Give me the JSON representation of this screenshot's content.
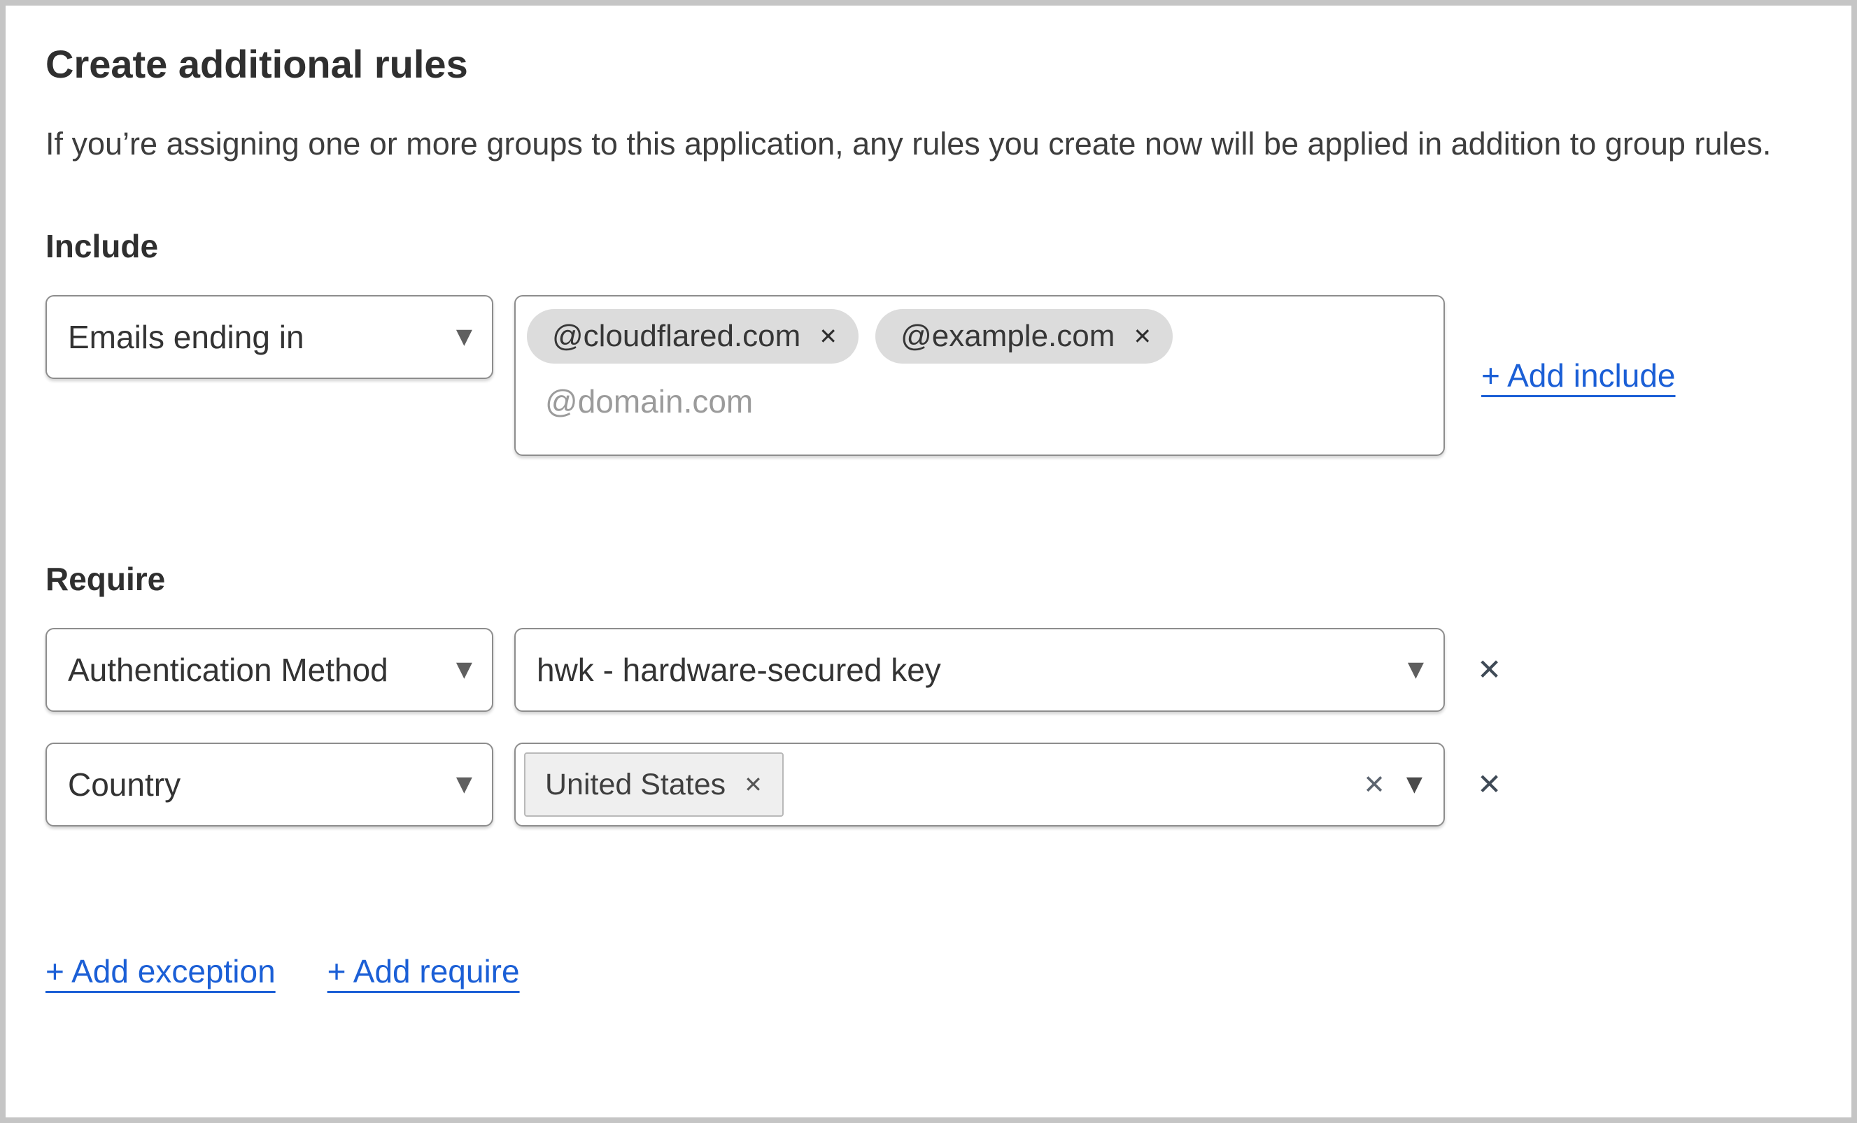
{
  "header": {
    "title": "Create additional rules",
    "description": "If you’re assigning one or more groups to this application, any rules you create now will be applied in addition to group rules."
  },
  "include_section": {
    "heading": "Include",
    "rule": {
      "selector_value": "Emails ending in",
      "tags": [
        {
          "label": "@cloudflared.com"
        },
        {
          "label": "@example.com"
        }
      ],
      "input_placeholder": "@domain.com"
    },
    "add_include_label": "+ Add include"
  },
  "require_section": {
    "heading": "Require",
    "rules": [
      {
        "selector_value": "Authentication Method",
        "value": "hwk - hardware-secured key"
      },
      {
        "selector_value": "Country",
        "tag": {
          "label": "United States"
        }
      }
    ],
    "add_exception_label": "+ Add exception",
    "add_require_label": "+ Add require"
  },
  "icons": {
    "chevron_down": "▼",
    "remove_tag": "✕",
    "clear_selection": "✕",
    "remove_rule": "✕"
  },
  "colors": {
    "link": "#1b5fd6",
    "text": "#363636",
    "border": "#8d8d8d",
    "frame": "#c5c5c5",
    "tag_bg": "#dcdcdc",
    "chip_bg": "#efefef",
    "placeholder": "#9b9b9b"
  }
}
